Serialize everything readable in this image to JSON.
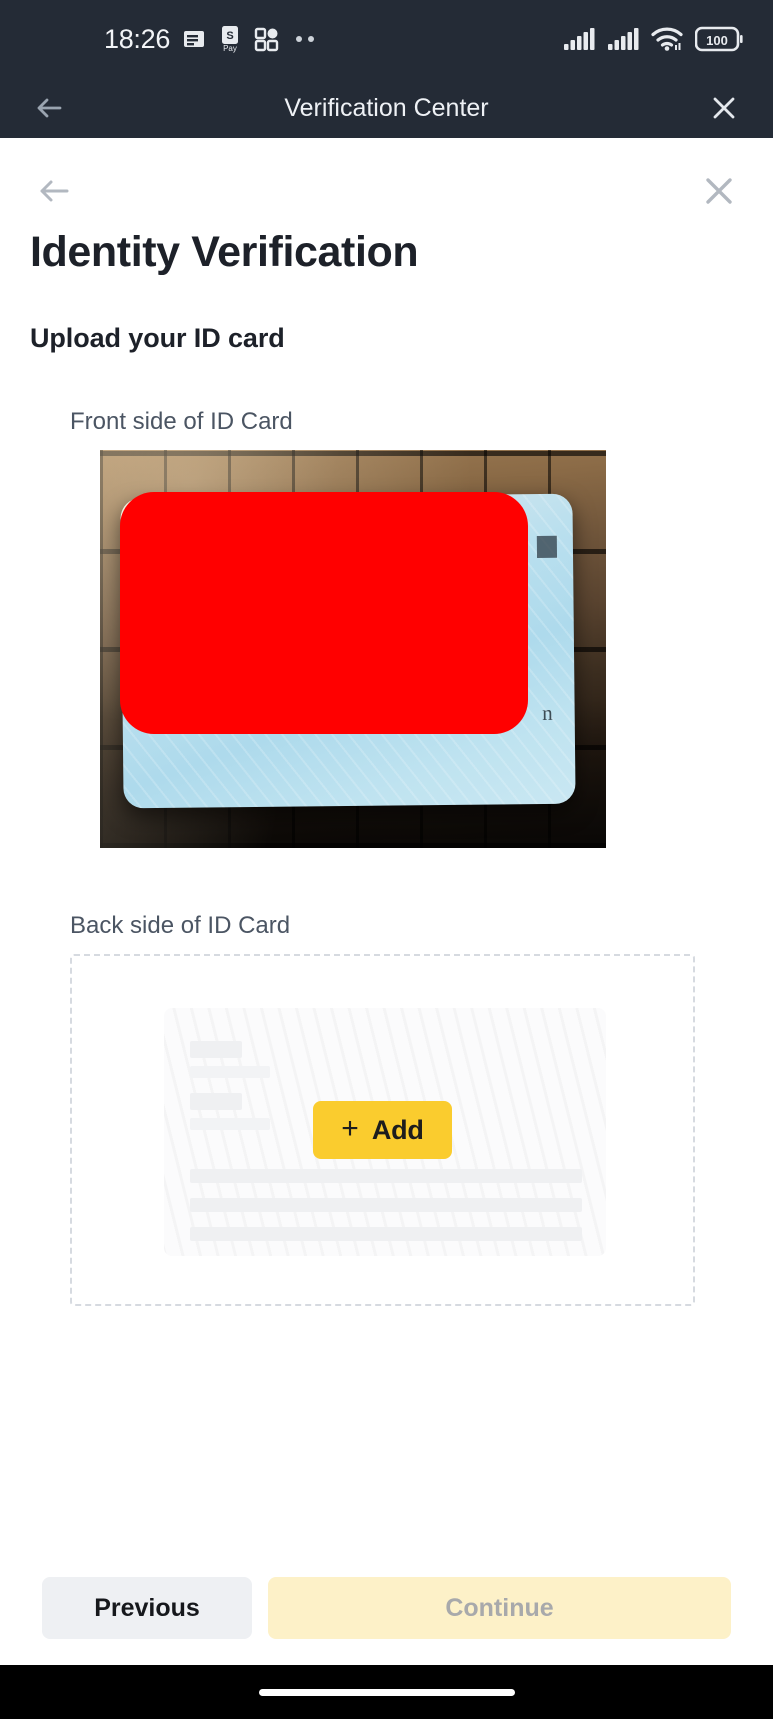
{
  "status_bar": {
    "time": "18:26",
    "icons_left": [
      "news-icon",
      "samsung-pay-icon",
      "apps-grid-icon",
      "more-dots-icon"
    ],
    "icons_right": [
      "signal-bars-sim1-icon",
      "signal-bars-sim2-icon",
      "wifi-icon",
      "battery-icon"
    ],
    "battery_level": "100"
  },
  "app_bar": {
    "title": "Verification Center",
    "back_icon": "arrow-left-icon",
    "close_icon": "close-icon"
  },
  "page": {
    "back_icon": "arrow-left-icon",
    "close_icon": "close-icon",
    "title": "Identity Verification",
    "section_title": "Upload your ID card"
  },
  "front_upload": {
    "label": "Front side of ID Card",
    "state": "uploaded",
    "redaction_color": "#ff0000"
  },
  "back_upload": {
    "label": "Back side of ID Card",
    "state": "empty",
    "add_plus": "+",
    "add_label": "Add",
    "add_button_color": "#facc2e"
  },
  "footer": {
    "previous_label": "Previous",
    "continue_label": "Continue",
    "continue_disabled": true,
    "continue_color": "#fdf1c8"
  },
  "nav_bar": {
    "home_indicator": "home-indicator"
  }
}
